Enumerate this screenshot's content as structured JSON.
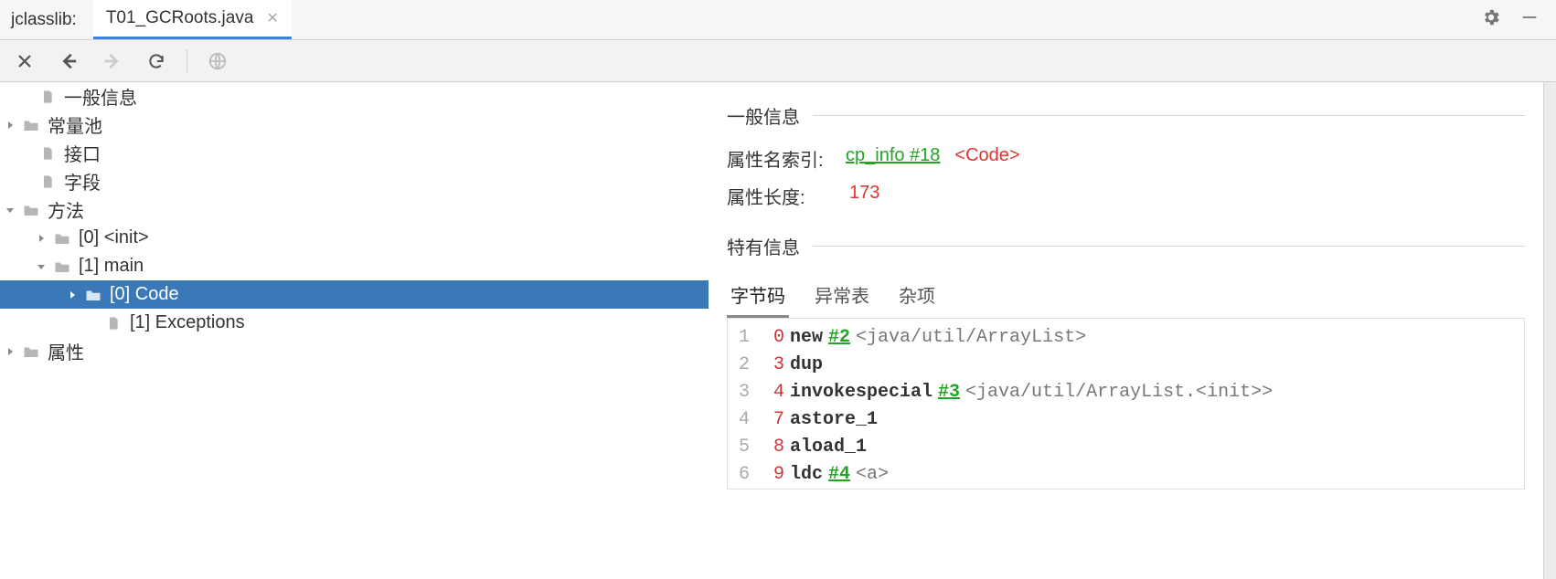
{
  "app": {
    "name": "jclasslib:"
  },
  "tab": {
    "label": "T01_GCRoots.java"
  },
  "tree": {
    "general": "一般信息",
    "constantPool": "常量池",
    "interfaces": "接口",
    "fields": "字段",
    "methods": "方法",
    "initLabel": "[0] <init>",
    "mainLabel": "[1] main",
    "codeLabel": "[0] Code",
    "exceptionsLabel": "[1] Exceptions",
    "attributes": "属性"
  },
  "detail": {
    "generalHeader": "一般信息",
    "specificHeader": "特有信息",
    "attrNameLabel": "属性名索引:",
    "attrNameLink": "cp_info #18",
    "attrNameDesc": "<Code>",
    "attrLenLabel": "属性长度:",
    "attrLenValue": "173",
    "innerTabs": {
      "bytecode": "字节码",
      "exceptions": "异常表",
      "misc": "杂项"
    },
    "bytecode": [
      {
        "ln": "1",
        "pc": "0",
        "op": "new",
        "ref": "#2",
        "desc": "<java/util/ArrayList>"
      },
      {
        "ln": "2",
        "pc": "3",
        "op": "dup",
        "ref": "",
        "desc": ""
      },
      {
        "ln": "3",
        "pc": "4",
        "op": "invokespecial",
        "ref": "#3",
        "desc": "<java/util/ArrayList.<init>>"
      },
      {
        "ln": "4",
        "pc": "7",
        "op": "astore_1",
        "ref": "",
        "desc": ""
      },
      {
        "ln": "5",
        "pc": "8",
        "op": "aload_1",
        "ref": "",
        "desc": ""
      },
      {
        "ln": "6",
        "pc": "9",
        "op": "ldc",
        "ref": "#4",
        "desc": "<a>"
      }
    ]
  }
}
